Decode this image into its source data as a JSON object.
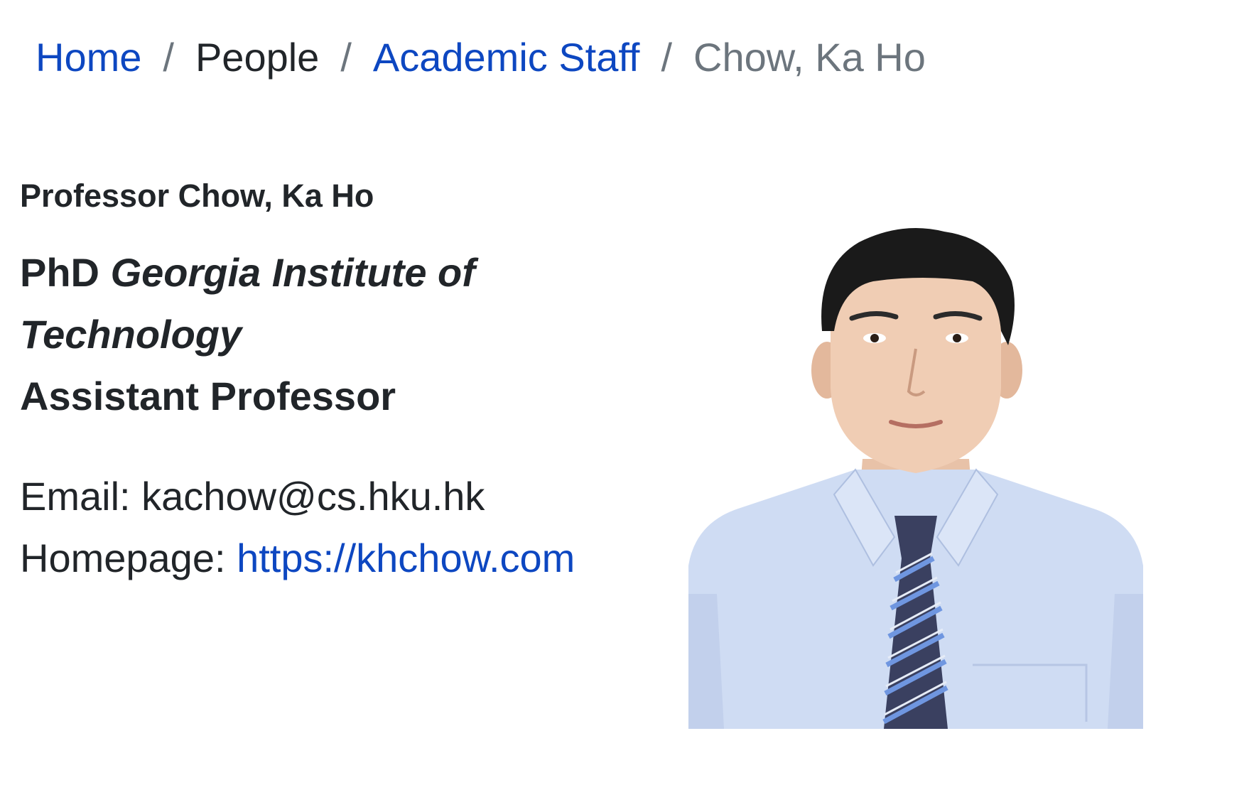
{
  "breadcrumb": {
    "home": "Home",
    "separator": "/",
    "people": "People",
    "academic_staff": "Academic Staff",
    "current": "Chow, Ka Ho"
  },
  "profile": {
    "name": "Professor Chow, Ka Ho",
    "degree_prefix": "PhD",
    "institution": "Georgia Institute of Technology",
    "position": "Assistant Professor",
    "email_label": "Email:",
    "email": "kachow@cs.hku.hk",
    "homepage_label": "Homepage:",
    "homepage_url": "https://khchow.com"
  },
  "colors": {
    "link": "#0d47c1",
    "text": "#212529",
    "muted": "#6c757d",
    "shirt": "#cfdcf3",
    "tie_dark": "#3a4060",
    "tie_stripe": "#6f96e0"
  }
}
